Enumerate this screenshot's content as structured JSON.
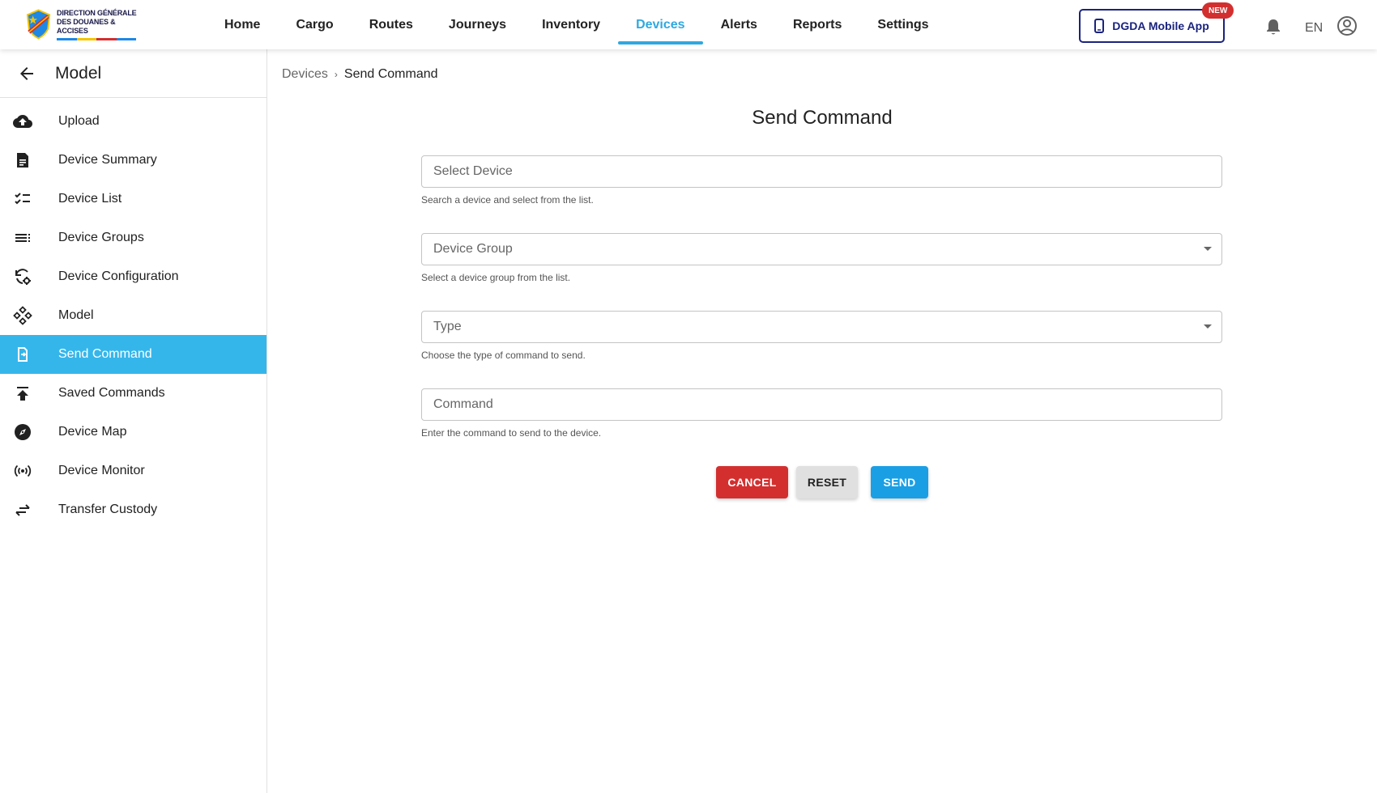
{
  "logo": {
    "line1": "DIRECTION GÉNÉRALE",
    "line2": "DES DOUANES & ACCISES"
  },
  "nav": {
    "items": [
      {
        "label": "Home",
        "active": false
      },
      {
        "label": "Cargo",
        "active": false
      },
      {
        "label": "Routes",
        "active": false
      },
      {
        "label": "Journeys",
        "active": false
      },
      {
        "label": "Inventory",
        "active": false
      },
      {
        "label": "Devices",
        "active": true
      },
      {
        "label": "Alerts",
        "active": false
      },
      {
        "label": "Reports",
        "active": false
      },
      {
        "label": "Settings",
        "active": false
      }
    ],
    "app_button": "DGDA Mobile App",
    "new_badge": "NEW",
    "language": "EN"
  },
  "sidebar": {
    "title": "Model",
    "items": [
      {
        "label": "Upload",
        "icon": "cloud-upload-icon"
      },
      {
        "label": "Device Summary",
        "icon": "summary-icon"
      },
      {
        "label": "Device List",
        "icon": "checklist-icon"
      },
      {
        "label": "Device Groups",
        "icon": "list-icon"
      },
      {
        "label": "Device Configuration",
        "icon": "config-icon"
      },
      {
        "label": "Model",
        "icon": "model-icon"
      },
      {
        "label": "Send Command",
        "icon": "send-command-icon",
        "active": true
      },
      {
        "label": "Saved Commands",
        "icon": "publish-icon"
      },
      {
        "label": "Device Map",
        "icon": "compass-icon"
      },
      {
        "label": "Device Monitor",
        "icon": "signal-icon"
      },
      {
        "label": "Transfer Custody",
        "icon": "transfer-icon"
      }
    ]
  },
  "breadcrumb": {
    "parent": "Devices",
    "separator": "›",
    "current": "Send Command"
  },
  "form": {
    "title": "Send Command",
    "device": {
      "placeholder": "Select Device",
      "helper": "Search a device and select from the list."
    },
    "group": {
      "placeholder": "Device Group",
      "helper": "Select a device group from the list."
    },
    "type": {
      "placeholder": "Type",
      "helper": "Choose the type of command to send."
    },
    "command": {
      "placeholder": "Command",
      "helper": "Enter the command to send to the device."
    },
    "cancel_label": "CANCEL",
    "reset_label": "RESET",
    "send_label": "SEND"
  },
  "colors": {
    "accent": "#2fa8e0",
    "sidebar_active": "#35b6eb",
    "cancel": "#d32f2f",
    "send": "#1a9fe5",
    "brand_navy": "#1a237e"
  }
}
